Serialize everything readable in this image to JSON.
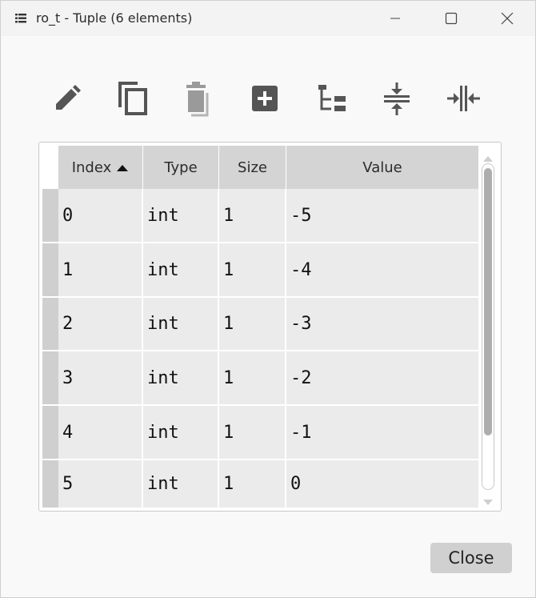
{
  "window": {
    "title": "ro_t - Tuple (6 elements)",
    "icon": "table-icon",
    "controls": [
      "minimize-icon",
      "maximize-icon",
      "close-icon"
    ]
  },
  "toolbar": {
    "buttons": [
      {
        "name": "edit",
        "icon": "pencil-icon"
      },
      {
        "name": "copy",
        "icon": "copy-icon"
      },
      {
        "name": "paste",
        "icon": "trash-icon"
      },
      {
        "name": "insert",
        "icon": "plus-square-icon"
      },
      {
        "name": "tree",
        "icon": "tree-icon"
      },
      {
        "name": "collapse",
        "icon": "collapse-rows-icon"
      },
      {
        "name": "resize-columns",
        "icon": "resize-columns-icon"
      }
    ]
  },
  "table": {
    "columns": [
      "Index",
      "Type",
      "Size",
      "Value"
    ],
    "sort_column": "Index",
    "sort_direction": "ascending",
    "rows": [
      {
        "index": "0",
        "type": "int",
        "size": "1",
        "value": "-5"
      },
      {
        "index": "1",
        "type": "int",
        "size": "1",
        "value": "-4"
      },
      {
        "index": "2",
        "type": "int",
        "size": "1",
        "value": "-3"
      },
      {
        "index": "3",
        "type": "int",
        "size": "1",
        "value": "-2"
      },
      {
        "index": "4",
        "type": "int",
        "size": "1",
        "value": "-1"
      },
      {
        "index": "5",
        "type": "int",
        "size": "1",
        "value": "0"
      }
    ]
  },
  "footer": {
    "close_label": "Close"
  },
  "colors": {
    "header_bg": "#d4d4d4",
    "cell_bg": "#ebebeb",
    "icon_fill": "#555555",
    "icon_disabled": "#9a9a9a"
  }
}
